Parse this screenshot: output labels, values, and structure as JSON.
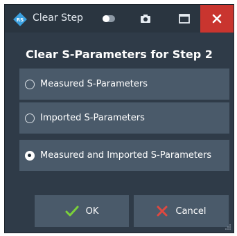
{
  "window": {
    "title": "Clear Step",
    "toolbar_icons": [
      "toggle-icon",
      "camera-icon",
      "maximize-icon",
      "close-icon"
    ]
  },
  "dialog": {
    "heading": "Clear S-Parameters for Step 2",
    "options": [
      {
        "label": "Measured S-Parameters",
        "selected": false
      },
      {
        "label": "Imported S-Parameters",
        "selected": false
      },
      {
        "label": "Measured and Imported S-Parameters",
        "selected": true
      }
    ],
    "ok_label": "OK",
    "cancel_label": "Cancel"
  },
  "colors": {
    "window_bg": "#2f3b48",
    "titlebar_bg": "#2a3540",
    "option_bg": "#4a5a6a",
    "close_bg": "#c9352f",
    "ok_check": "#7bd13a",
    "cancel_x": "#e0483f",
    "app_icon": "#3aa0e0"
  }
}
